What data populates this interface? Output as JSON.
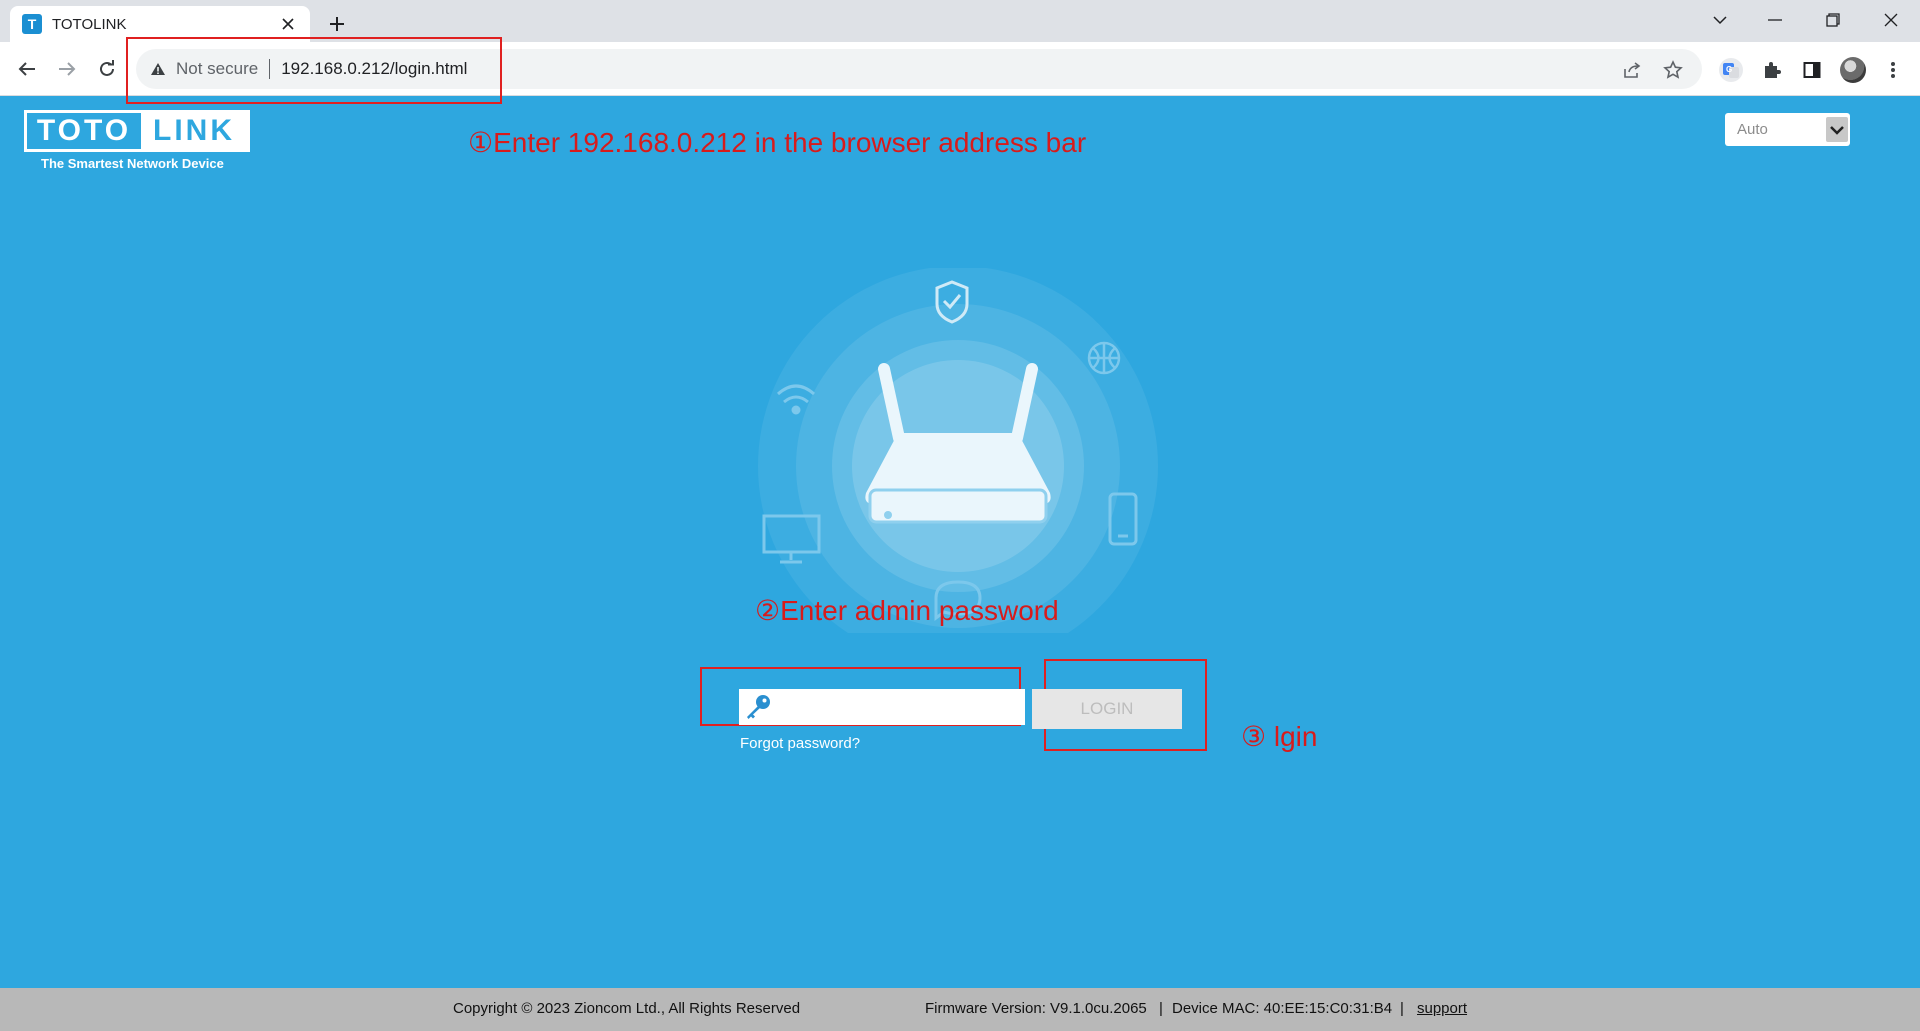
{
  "browser": {
    "tab_title": "TOTOLINK",
    "favicon_letter": "T",
    "security_label": "Not secure",
    "url": "192.168.0.212/login.html",
    "accent": "#2ea7df"
  },
  "header": {
    "logo_left": "TOTO",
    "logo_right": "LINK",
    "tagline": "The Smartest Network Device",
    "language_selected": "Auto"
  },
  "annotations": {
    "step1": "①Enter 192.168.0.212 in the browser address bar",
    "step2": "②Enter admin password",
    "step3": "③ lgin",
    "color": "#d81b1b"
  },
  "login": {
    "password_value": "",
    "button_label": "LOGIN",
    "forgot_label": "Forgot password?"
  },
  "footer": {
    "copyright": "Copyright © 2023 Zioncom Ltd., All Rights Reserved",
    "firmware": "Firmware Version: V9.1.0cu.2065",
    "mac": "Device MAC: 40:EE:15:C0:31:B4",
    "sep1": "|",
    "sep2": "|",
    "support": "support"
  }
}
